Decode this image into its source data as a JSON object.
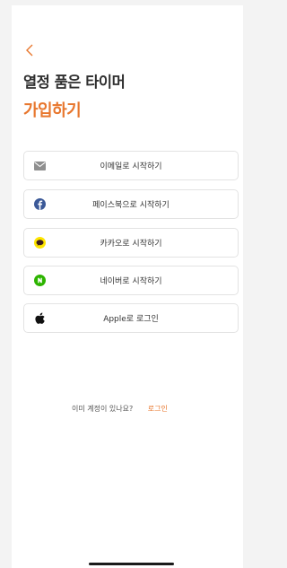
{
  "header": {
    "back_icon": "chevron-left-icon",
    "title_line1": "열정 품은 타이머",
    "title_line2": "가입하기"
  },
  "colors": {
    "accent": "#e8772e",
    "facebook": "#3b5998",
    "kakao": "#fee500",
    "naver": "#2db400"
  },
  "login_options": [
    {
      "label": "이메일로 시작하기",
      "icon": "mail-icon"
    },
    {
      "label": "페이스북으로 시작하기",
      "icon": "facebook-icon"
    },
    {
      "label": "카카오로 시작하기",
      "icon": "kakao-icon"
    },
    {
      "label": "네이버로 시작하기",
      "icon": "naver-icon"
    },
    {
      "label": "Apple로 로그인",
      "icon": "apple-icon"
    }
  ],
  "footer": {
    "question": "이미 계정이 있나요?",
    "login_link": "로그인"
  }
}
